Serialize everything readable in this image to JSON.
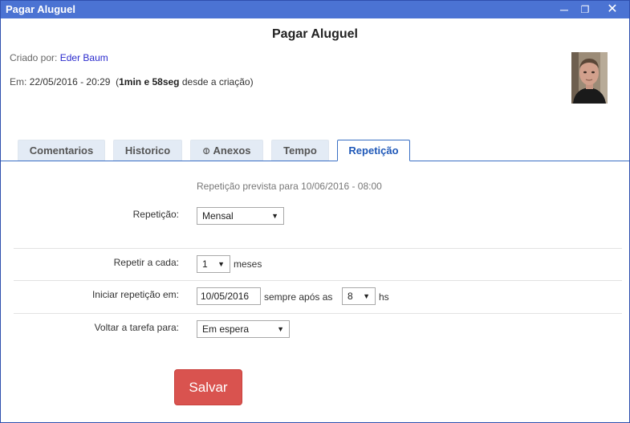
{
  "window": {
    "title": "Pagar Aluguel",
    "controls": {
      "minimize": "─",
      "maximize": "❐",
      "close": "✕"
    }
  },
  "header": {
    "title": "Pagar Aluguel",
    "created_by_label": "Criado por:",
    "created_by_name": "Eder Baum",
    "date_label": "Em:",
    "date_value": "22/05/2016 - 20:29",
    "elapsed_open": "(",
    "elapsed_bold": "1min e 58seg",
    "elapsed_rest": "desde a criação)"
  },
  "tabs": [
    {
      "label": "Comentarios",
      "active": false
    },
    {
      "label": "Historico",
      "active": false
    },
    {
      "label": "Anexos",
      "active": false,
      "icon": "paperclip-icon"
    },
    {
      "label": "Tempo",
      "active": false
    },
    {
      "label": "Repetição",
      "active": true
    }
  ],
  "form": {
    "preview_text": "Repetição prevista para 10/06/2016 - 08:00",
    "repeticao_label": "Repetição:",
    "repeticao_value": "Mensal",
    "repetir_label": "Repetir a cada:",
    "repetir_value": "1",
    "repetir_unit": "meses",
    "iniciar_label": "Iniciar repetição em:",
    "iniciar_date": "10/05/2016",
    "sempre_apos": "sempre após as",
    "hora_value": "8",
    "hora_unit": "hs",
    "voltar_label": "Voltar a tarefa para:",
    "voltar_value": "Em espera",
    "save_label": "Salvar"
  },
  "colors": {
    "titlebar": "#4b73d3",
    "accent": "#1f58b8",
    "save": "#d9534f"
  }
}
